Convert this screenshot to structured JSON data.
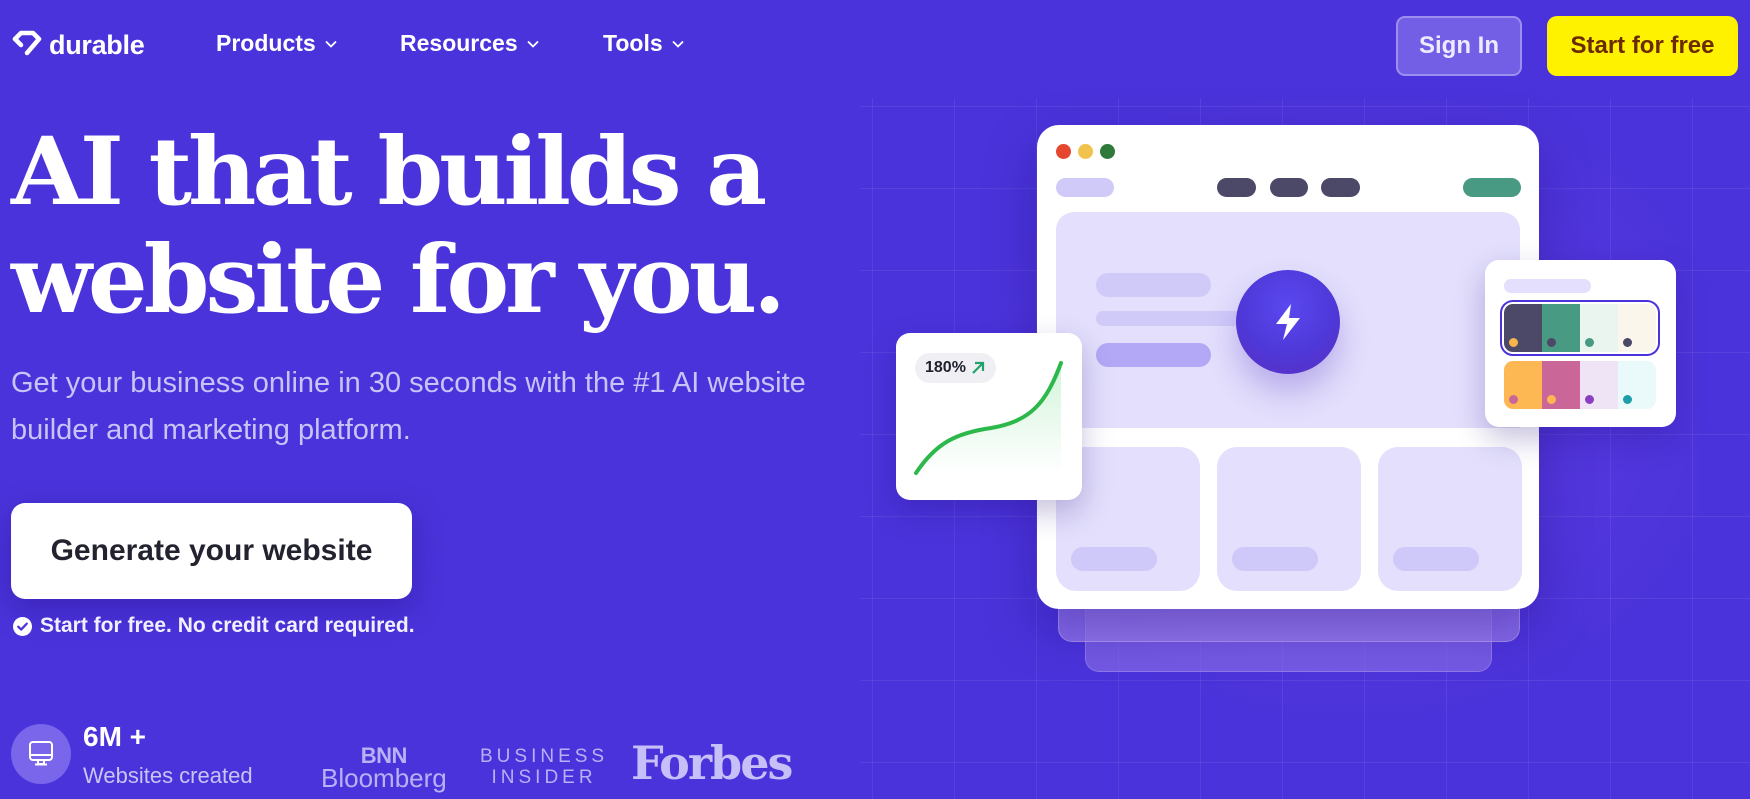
{
  "brand": {
    "name": "durable",
    "icon": "diamond-logo-icon"
  },
  "nav": {
    "items": [
      {
        "label": "Products",
        "icon": "chevron-down-icon"
      },
      {
        "label": "Resources",
        "icon": "chevron-down-icon"
      },
      {
        "label": "Tools",
        "icon": "chevron-down-icon"
      }
    ],
    "sign_in_label": "Sign In",
    "start_label": "Start for free"
  },
  "hero": {
    "headline_line1": "AI that builds a",
    "headline_line2": "website for you.",
    "subtitle": "Get your business online in 30 seconds with the #1 AI website builder and marketing platform.",
    "cta_label": "Generate your website",
    "note": "Start for free. No credit card required.",
    "note_icon": "check-circle-icon"
  },
  "stats": {
    "icon": "monitor-icon",
    "value": "6M +",
    "label": "Websites created"
  },
  "press": {
    "bnn_line1": "BNN",
    "bnn_line2": "Bloomberg",
    "bi_line1": "BUSINESS",
    "bi_line2": "INSIDER",
    "forbes": "Forbes"
  },
  "illustration": {
    "growth_badge": "180%",
    "growth_icon": "arrow-up-right-icon",
    "center_icon": "lightning-bolt-icon",
    "window_dots": [
      "#e6452e",
      "#f2c34c",
      "#2e7a3a"
    ],
    "palettes": [
      {
        "selected": true,
        "swatches": [
          {
            "bg": "#4b4868",
            "dot": "#f5b54a"
          },
          {
            "bg": "#489a83",
            "dot": "#4b4868"
          },
          {
            "bg": "#e9f5ee",
            "dot": "#489a83"
          },
          {
            "bg": "#faf6ec",
            "dot": "#4b4868"
          }
        ]
      },
      {
        "selected": false,
        "swatches": [
          {
            "bg": "#fdb853",
            "dot": "#cb6699"
          },
          {
            "bg": "#cb6699",
            "dot": "#fdb853"
          },
          {
            "bg": "#efe4f6",
            "dot": "#8a3fc0"
          },
          {
            "bg": "#eafafb",
            "dot": "#1d9ea8"
          }
        ]
      }
    ]
  },
  "colors": {
    "background": "#4a33da",
    "accent_yellow": "#fff200",
    "start_text": "#6b2a00",
    "subtitle": "#c9c3f7",
    "green_pill": "#489a83",
    "dark_pill": "#4b4868"
  }
}
